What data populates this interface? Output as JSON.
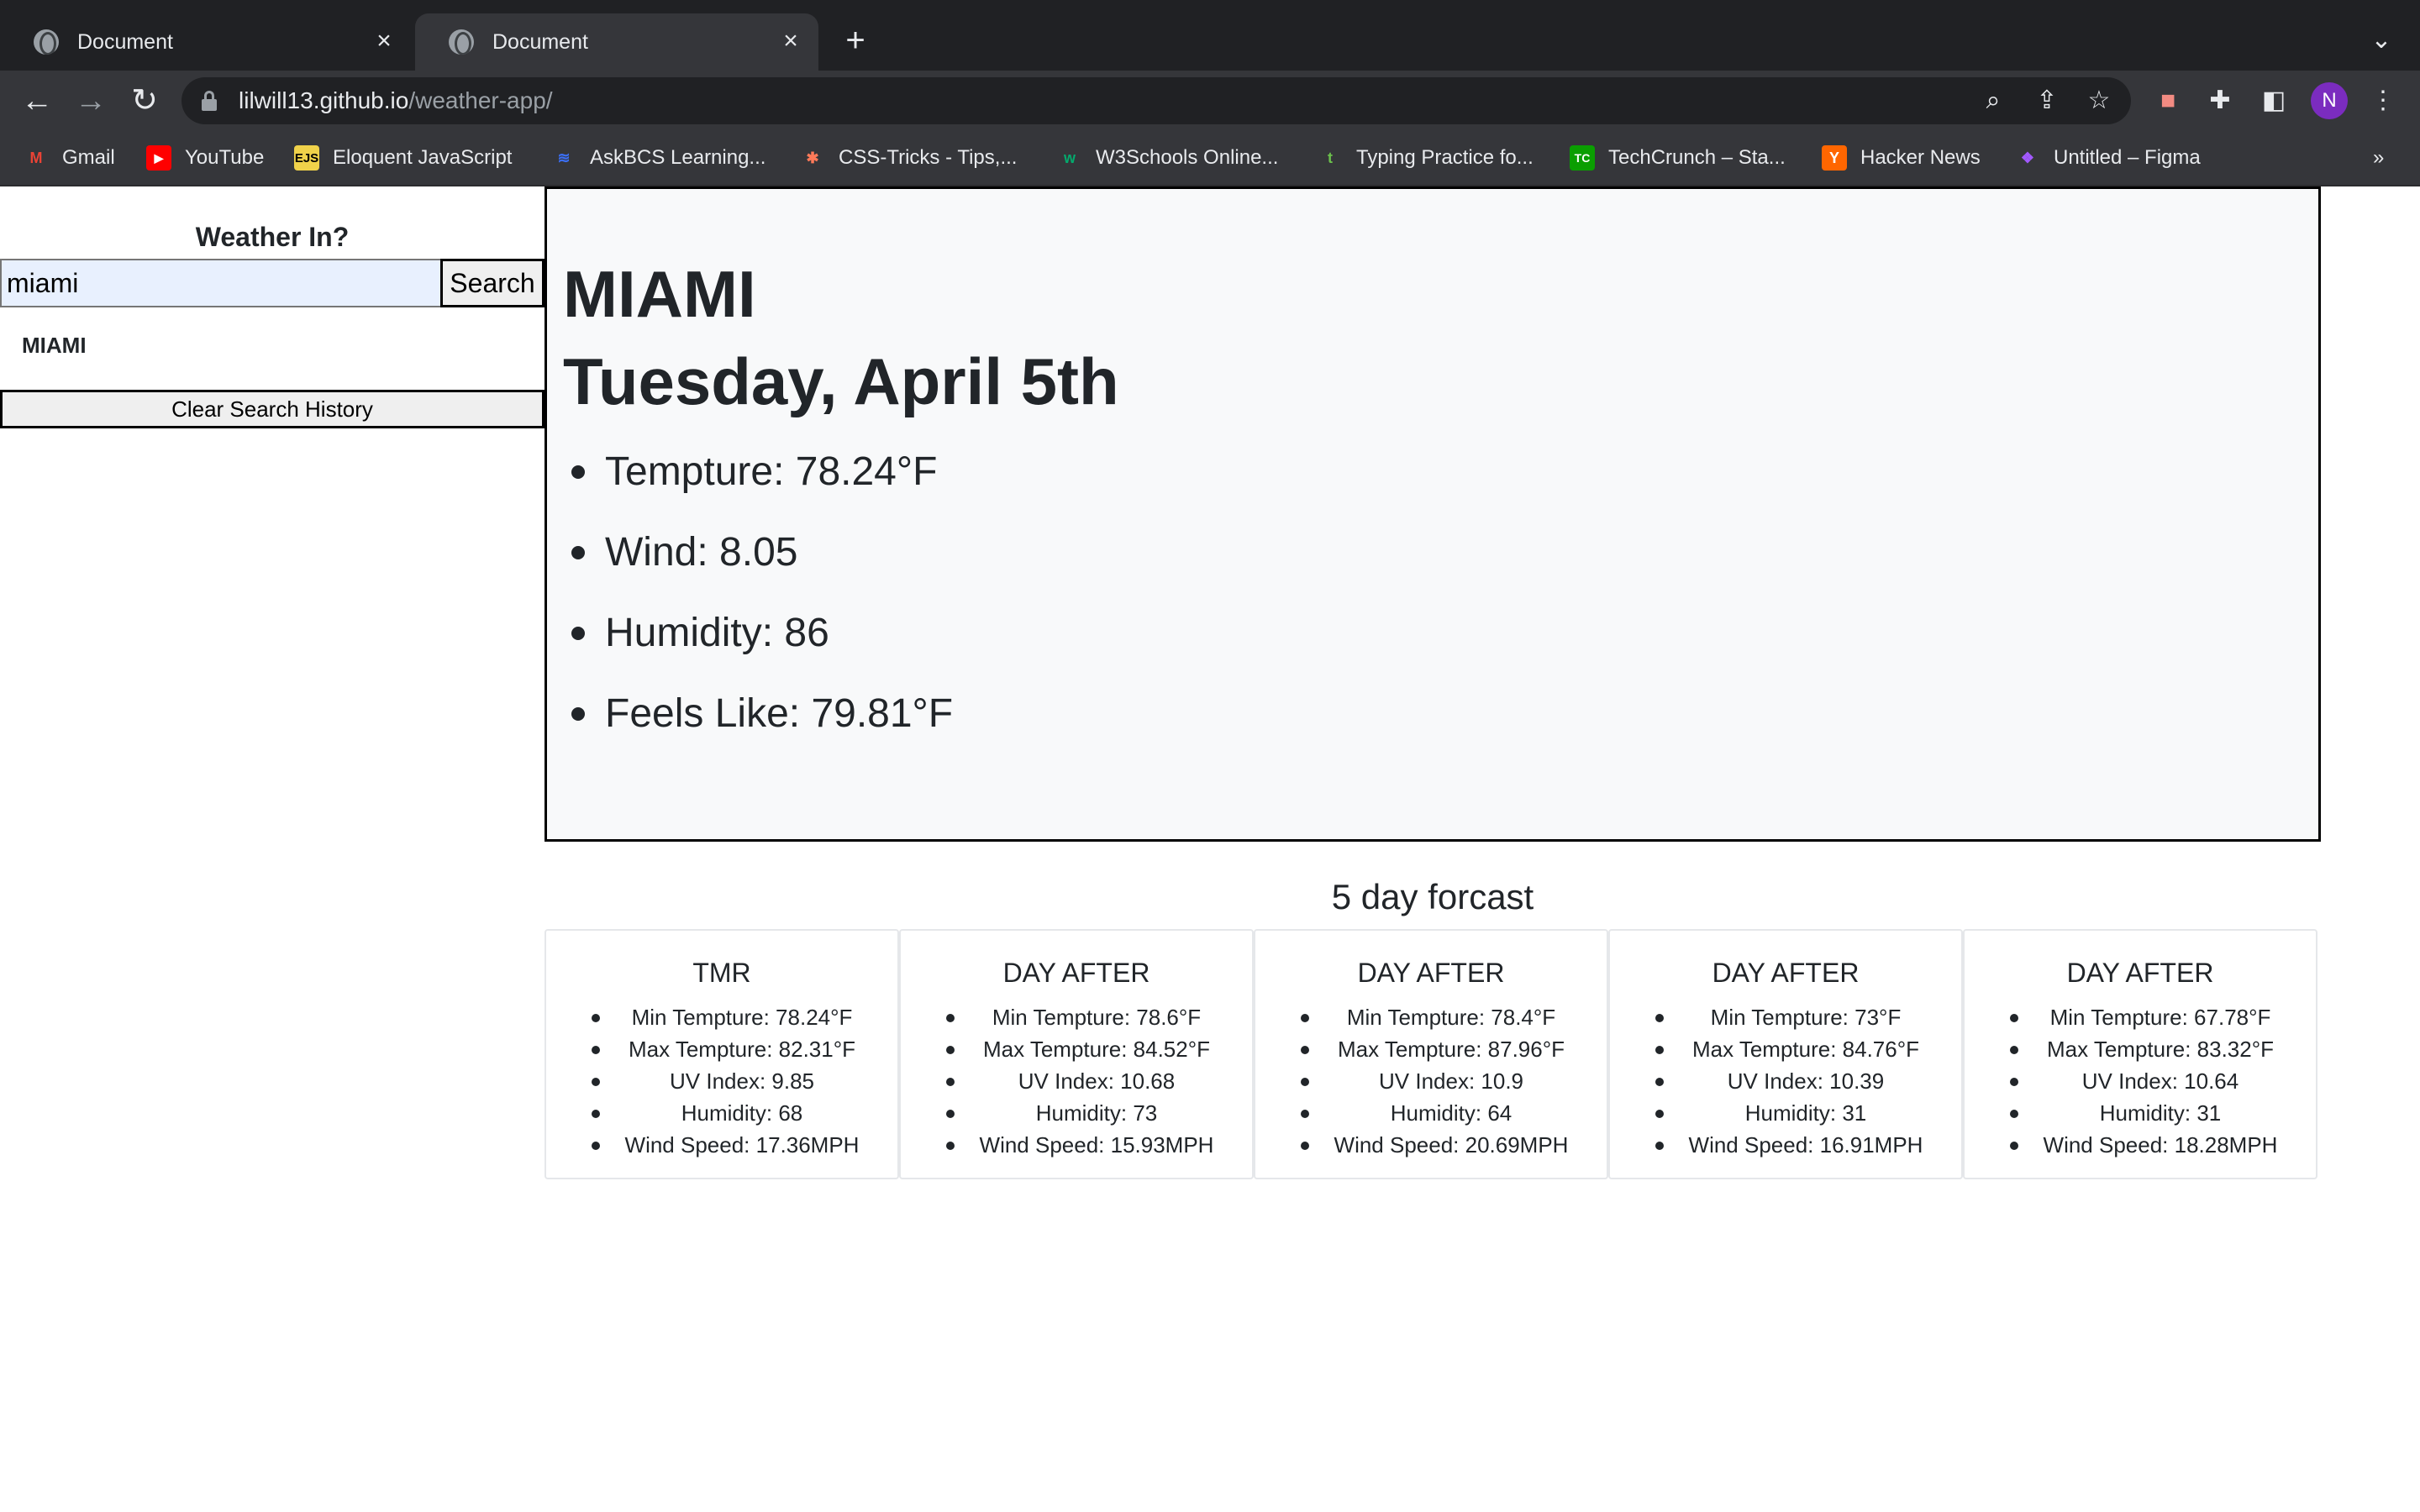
{
  "browser": {
    "tabs": [
      {
        "title": "Document"
      },
      {
        "title": "Document"
      }
    ],
    "url": {
      "host": "lilwill13.github.io",
      "path": "/weather-app/"
    },
    "profile_initial": "N",
    "bookmarks": [
      {
        "label": "Gmail",
        "icon": "gmail-icon"
      },
      {
        "label": "YouTube",
        "icon": "youtube-icon"
      },
      {
        "label": "Eloquent JavaScript",
        "icon": "ejs-icon"
      },
      {
        "label": "AskBCS Learning...",
        "icon": "askbcs-icon"
      },
      {
        "label": "CSS-Tricks - Tips,...",
        "icon": "css-tricks-icon"
      },
      {
        "label": "W3Schools Online...",
        "icon": "w3schools-icon"
      },
      {
        "label": "Typing Practice fo...",
        "icon": "typing-icon"
      },
      {
        "label": "TechCrunch – Sta...",
        "icon": "techcrunch-icon"
      },
      {
        "label": "Hacker News",
        "icon": "hacker-news-icon"
      },
      {
        "label": "Untitled – Figma",
        "icon": "figma-icon"
      }
    ],
    "bookmarks_overflow": "»"
  },
  "sidebar": {
    "heading": "Weather In?",
    "search_value": "miami",
    "search_button": "Search",
    "history": [
      "MIAMI"
    ],
    "clear_button": "Clear Search History"
  },
  "current": {
    "city": "MIAMI",
    "date": "Tuesday, April 5th",
    "items": [
      "Tempture: 78.24°F",
      "Wind: 8.05",
      "Humidity: 86",
      "Feels Like: 79.81°F"
    ]
  },
  "forecast": {
    "title": "5 day forcast",
    "days": [
      {
        "label": "TMR",
        "items": [
          "Min Tempture: 78.24°F",
          "Max Tempture: 82.31°F",
          "UV Index: 9.85",
          "Humidity: 68",
          "Wind Speed: 17.36MPH"
        ]
      },
      {
        "label": "DAY AFTER",
        "items": [
          "Min Tempture: 78.6°F",
          "Max Tempture: 84.52°F",
          "UV Index: 10.68",
          "Humidity: 73",
          "Wind Speed: 15.93MPH"
        ]
      },
      {
        "label": "DAY AFTER",
        "items": [
          "Min Tempture: 78.4°F",
          "Max Tempture: 87.96°F",
          "UV Index: 10.9",
          "Humidity: 64",
          "Wind Speed: 20.69MPH"
        ]
      },
      {
        "label": "DAY AFTER",
        "items": [
          "Min Tempture: 73°F",
          "Max Tempture: 84.76°F",
          "UV Index: 10.39",
          "Humidity: 31",
          "Wind Speed: 16.91MPH"
        ]
      },
      {
        "label": "DAY AFTER",
        "items": [
          "Min Tempture: 67.78°F",
          "Max Tempture: 83.32°F",
          "UV Index: 10.64",
          "Humidity: 31",
          "Wind Speed: 18.28MPH"
        ]
      }
    ]
  }
}
